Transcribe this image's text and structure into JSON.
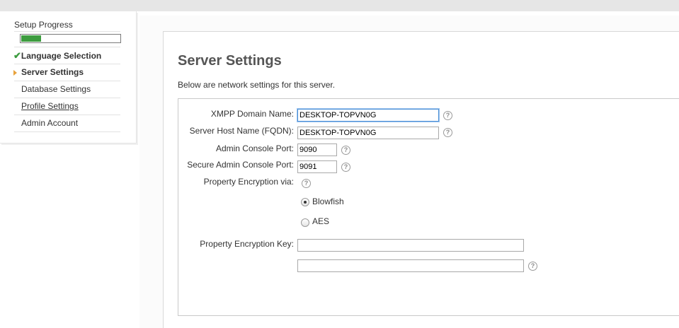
{
  "sidebar": {
    "title": "Setup Progress",
    "progress_fraction": 0.2,
    "steps": [
      {
        "label": "Language Selection",
        "status": "done",
        "check": "✔"
      },
      {
        "label": "Server Settings",
        "status": "current"
      },
      {
        "label": "Database Settings",
        "status": "pending"
      },
      {
        "label": "Profile Settings",
        "status": "pending"
      },
      {
        "label": "Admin Account",
        "status": "pending"
      }
    ]
  },
  "main": {
    "title": "Server Settings",
    "description": "Below are network settings for this server.",
    "fields": {
      "xmpp_domain": {
        "label": "XMPP Domain Name:",
        "value": "DESKTOP-TOPVN0G"
      },
      "host_name": {
        "label": "Server Host Name (FQDN):",
        "value": "DESKTOP-TOPVN0G"
      },
      "admin_port": {
        "label": "Admin Console Port:",
        "value": "9090"
      },
      "secure_admin_port": {
        "label": "Secure Admin Console Port:",
        "value": "9091"
      },
      "encryption": {
        "label": "Property Encryption via:",
        "options": [
          {
            "label": "Blowfish",
            "selected": true
          },
          {
            "label": "AES",
            "selected": false
          }
        ]
      },
      "encryption_key": {
        "label": "Property Encryption Key:",
        "value": "",
        "confirm_value": ""
      }
    },
    "help_glyph": "?"
  },
  "colors": {
    "progress_green": "#3d9c3f",
    "current_arrow": "#e8a23c",
    "title_gray": "#555555"
  }
}
